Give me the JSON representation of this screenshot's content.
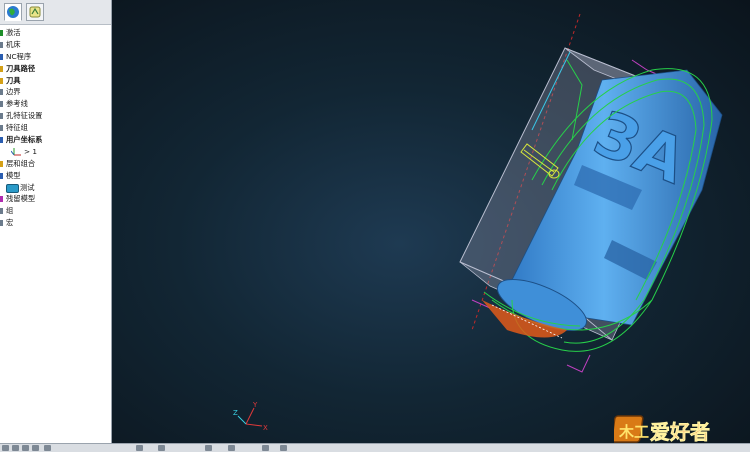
{
  "panel": {
    "tabs": [
      {
        "name": "explorer-tab",
        "icon": "globe-icon",
        "active": true
      },
      {
        "name": "toolpath-tab",
        "icon": "toolpath-icon",
        "active": false
      }
    ],
    "tree": [
      {
        "label": "激活",
        "marker": "#1e8f2a",
        "bold": false
      },
      {
        "label": "机床",
        "marker": "#6b7b8c",
        "bold": false
      },
      {
        "label": "NC程序",
        "marker": "#2a5db0",
        "bold": false
      },
      {
        "label": "刀具路径",
        "marker": "#d4a017",
        "bold": true
      },
      {
        "label": "刀具",
        "marker": "#d4a017",
        "bold": true
      },
      {
        "label": "边界",
        "marker": "#6b7b8c",
        "bold": false
      },
      {
        "label": "参考线",
        "marker": "#6b7b8c",
        "bold": false
      },
      {
        "label": "孔特征设置",
        "marker": "#6b7b8c",
        "bold": false
      },
      {
        "label": "特征组",
        "marker": "#6b7b8c",
        "bold": false
      },
      {
        "label": "用户坐标系",
        "marker": "#2a5db0",
        "bold": true
      }
    ],
    "ucs_item": {
      "label": "> 1",
      "icon": "ucs-axes-icon"
    },
    "tree_after": [
      {
        "label": "层和组合",
        "marker": "#d4a017",
        "bold": false
      },
      {
        "label": "模型",
        "marker": "#2a5db0",
        "bold": false
      }
    ],
    "model_child": {
      "label": "测试",
      "icon": "model-solid-icon"
    },
    "tree_tail": [
      {
        "label": "残留模型",
        "marker": "#b02ab0",
        "bold": false
      },
      {
        "label": "组",
        "marker": "#6b7b8c",
        "bold": false
      },
      {
        "label": "宏",
        "marker": "#6b7b8c",
        "bold": false
      }
    ]
  },
  "viewport": {
    "part_text": "3A",
    "axis_labels": {
      "x": "X",
      "y": "Y",
      "z": "Z"
    },
    "colors": {
      "part": "#3e8fd8",
      "stock": "#8f93a8",
      "toolpath": "#27d04a",
      "block_edge": "#c040c0",
      "tool": "#d8e83a"
    }
  },
  "watermark": {
    "text": "爱好者",
    "badge": "木工"
  }
}
